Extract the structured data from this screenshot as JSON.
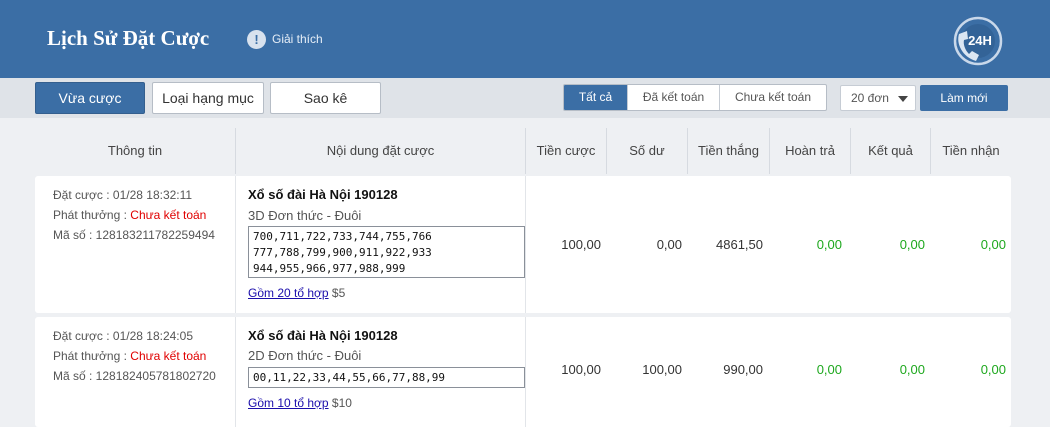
{
  "header": {
    "title": "Lịch Sử Đặt Cược",
    "help_label": "Giải thích",
    "hotline_label": "24H"
  },
  "toolbar": {
    "tabs": [
      "Vừa cược",
      "Loại hạng mục",
      "Sao kê"
    ],
    "filters": [
      "Tất cả",
      "Đã kết toán",
      "Chưa kết toán"
    ],
    "page_size": "20 đơn",
    "refresh_label": "Làm mới"
  },
  "table": {
    "columns": [
      "Thông tin",
      "Nội dung đặt cược",
      "Tiền cược",
      "Số dư",
      "Tiền thắng",
      "Hoàn trả",
      "Kết quả",
      "Tiền nhận"
    ],
    "rows": [
      {
        "bet_time_label": "Đặt cược : 01/28 18:32:11",
        "payout_label": "Phát thưởng : ",
        "payout_status": "Chưa kết toán",
        "id_label": "Mã số : 128183211782259494",
        "lottery": "Xổ số đài Hà Nội 190128",
        "bet_type": "3D Đơn thức - Đuôi",
        "numbers_line1": "700,711,722,733,744,755,766",
        "numbers_line2": "777,788,799,900,911,922,933",
        "numbers_line3": "944,955,966,977,988,999",
        "combo_link": "Gồm 20 tổ hợp",
        "combo_amount": " $5",
        "stake": "100,00",
        "balance": "0,00",
        "win": "4861,50",
        "refund": "0,00",
        "result": "0,00",
        "received": "0,00"
      },
      {
        "bet_time_label": "Đặt cược : 01/28 18:24:05",
        "payout_label": "Phát thưởng : ",
        "payout_status": "Chưa kết toán",
        "id_label": "Mã số : 128182405781802720",
        "lottery": "Xổ số đài Hà Nội 190128",
        "bet_type": "2D Đơn thức - Đuôi",
        "numbers_line1": "00,11,22,33,44,55,66,77,88,99",
        "combo_link": "Gồm 10 tổ hợp",
        "combo_amount": " $10",
        "stake": "100,00",
        "balance": "100,00",
        "win": "990,00",
        "refund": "0,00",
        "result": "0,00",
        "received": "0,00"
      }
    ]
  },
  "colors": {
    "header_bg": "#3b6ea5",
    "accent": "#3b6ea5",
    "status_red": "#e00000",
    "value_green": "#1ea81e",
    "link": "#1a0dab"
  },
  "icons": [
    "info-icon",
    "hotline-24h-icon",
    "dropdown-arrow-icon"
  ]
}
